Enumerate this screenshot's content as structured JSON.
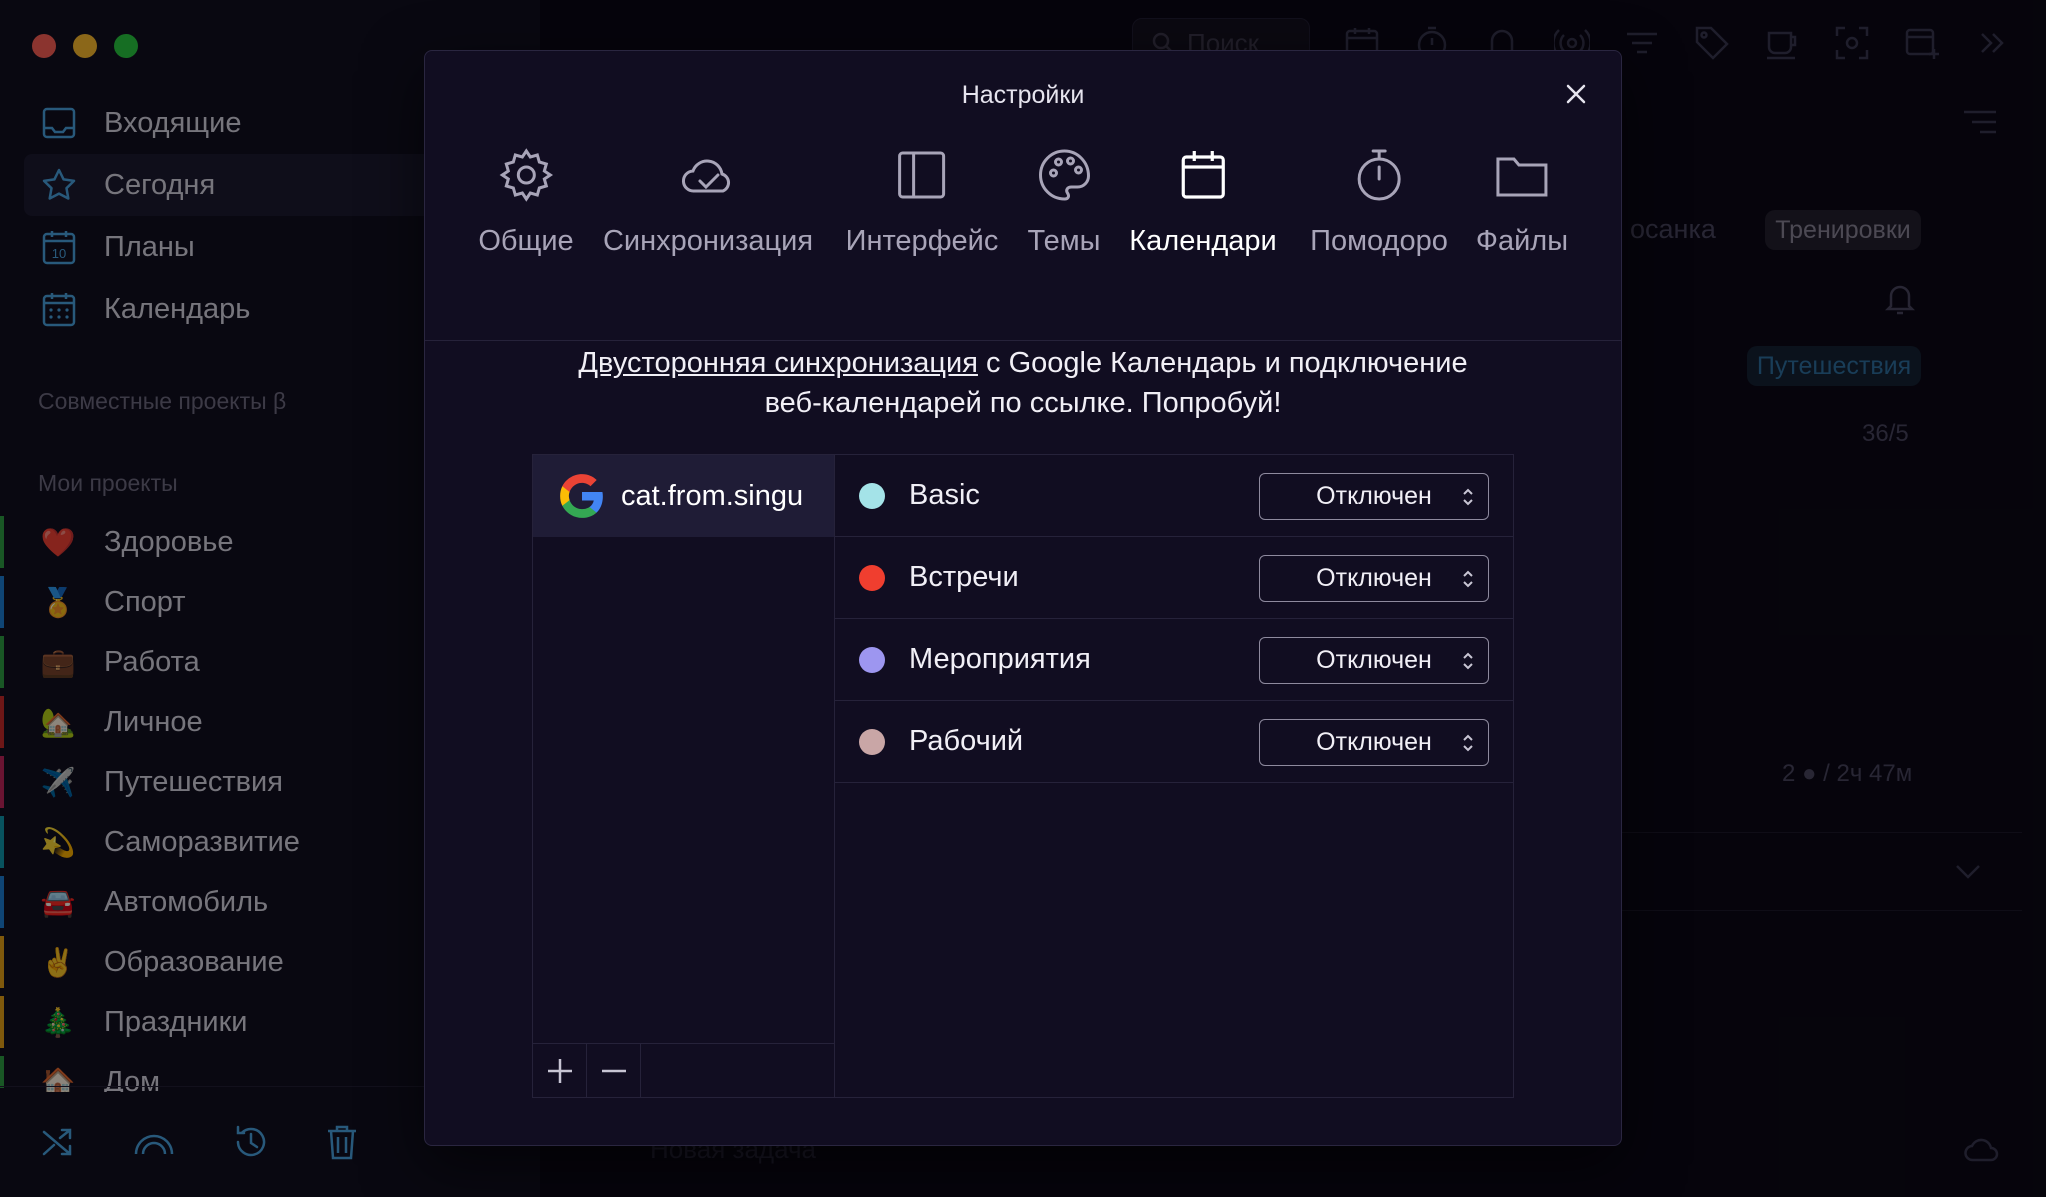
{
  "sidebar": {
    "nav": [
      {
        "label": "Входящие",
        "icon": "inbox-icon"
      },
      {
        "label": "Сегодня",
        "icon": "star-icon"
      },
      {
        "label": "Планы",
        "icon": "calendar-10-icon"
      },
      {
        "label": "Календарь",
        "icon": "calendar-grid-icon"
      }
    ],
    "shared_title": "Совместные проекты β",
    "my_projects_title": "Мои проекты",
    "projects": [
      {
        "label": "Здоровье",
        "emoji": "❤️",
        "color": "#2f9e44"
      },
      {
        "label": "Спорт",
        "emoji": "🏅",
        "color": "#1c7ed6"
      },
      {
        "label": "Работа",
        "emoji": "💼",
        "color": "#2f9e44"
      },
      {
        "label": "Личное",
        "emoji": "🏡",
        "color": "#c92a2a"
      },
      {
        "label": "Путешествия",
        "emoji": "✈️",
        "color": "#c2255c"
      },
      {
        "label": "Саморазвитие",
        "emoji": "💫",
        "color": "#1098ad"
      },
      {
        "label": "Автомобиль",
        "emoji": "🚘",
        "color": "#1c7ed6"
      },
      {
        "label": "Образование",
        "emoji": "✌️",
        "color": "#e8a317"
      },
      {
        "label": "Праздники",
        "emoji": "🎄",
        "color": "#e8a317"
      },
      {
        "label": "Дом",
        "emoji": "🏠",
        "color": "#2f9e44"
      }
    ]
  },
  "main": {
    "search_placeholder": "Поиск",
    "tag_fragment": "осанка",
    "tag_trainings": "Тренировки",
    "tag_travel": "Путешествия",
    "count": "36/5",
    "stats": "2 ● / 2ч 47м",
    "new_task": "Новая задача"
  },
  "modal": {
    "title": "Настройки",
    "tabs": [
      {
        "label": "Общие",
        "icon": "gear-icon"
      },
      {
        "label": "Синхронизация",
        "icon": "cloud-check-icon"
      },
      {
        "label": "Интерфейс",
        "icon": "sidebar-layout-icon"
      },
      {
        "label": "Темы",
        "icon": "palette-icon"
      },
      {
        "label": "Календари",
        "icon": "calendar-icon"
      },
      {
        "label": "Помодоро",
        "icon": "stopwatch-icon"
      },
      {
        "label": "Файлы",
        "icon": "folder-icon"
      }
    ],
    "active_tab": "Календари",
    "promo_link": "Двусторонняя синхронизация",
    "promo_line1_rest": " с Google Календарь и подключение",
    "promo_line2": "веб-календарей по ссылке. Попробуй!",
    "account": {
      "email": "cat.from.singu",
      "icon": "google-icon"
    },
    "calendars": [
      {
        "name": "Basic",
        "color": "#a4e3e8",
        "status": "Отключен"
      },
      {
        "name": "Встречи",
        "color": "#f03e2f",
        "status": "Отключен"
      },
      {
        "name": "Мероприятия",
        "color": "#9d96f0",
        "status": "Отключен"
      },
      {
        "name": "Рабочий",
        "color": "#c9a6a6",
        "status": "Отключен"
      }
    ]
  }
}
